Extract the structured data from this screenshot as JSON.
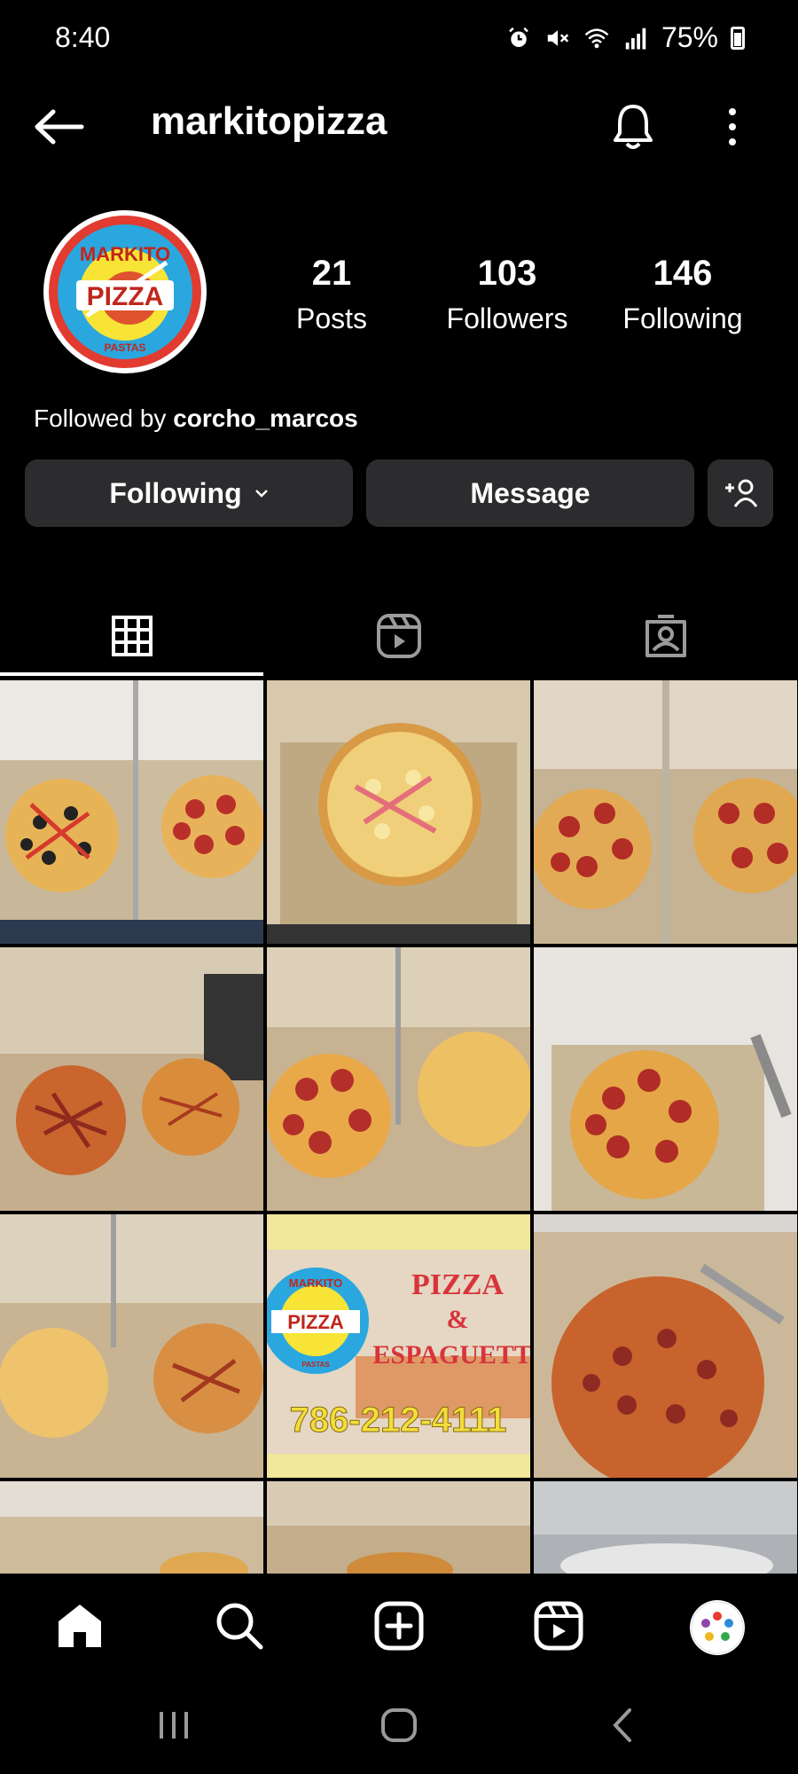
{
  "status_bar": {
    "time": "8:40",
    "battery": "75%",
    "icons": [
      "alarm-icon",
      "mute-icon",
      "wifi-icon",
      "signal-icon",
      "battery-icon"
    ]
  },
  "header": {
    "username": "markitopizza",
    "icons": [
      "back-arrow-icon",
      "bell-icon",
      "more-vertical-icon"
    ]
  },
  "profile": {
    "logo_text": {
      "top": "MARKITO",
      "main": "PIZZA",
      "bottom": "PASTAS"
    },
    "stats": [
      {
        "value": "21",
        "label": "Posts"
      },
      {
        "value": "103",
        "label": "Followers"
      },
      {
        "value": "146",
        "label": "Following"
      }
    ],
    "followed_by_prefix": "Followed by",
    "followed_by_user": "corcho_marcos"
  },
  "actions": {
    "following_label": "Following",
    "message_label": "Message"
  },
  "tabs": [
    {
      "name": "grid",
      "icon": "grid-icon",
      "active": true
    },
    {
      "name": "reels",
      "icon": "reels-icon",
      "active": false
    },
    {
      "name": "tagged",
      "icon": "tagged-icon",
      "active": false
    }
  ],
  "posts": [
    {
      "kind": "two-pizzas"
    },
    {
      "kind": "hawaiian-pizza"
    },
    {
      "kind": "two-pepperoni"
    },
    {
      "kind": "two-pizzas-bacon"
    },
    {
      "kind": "pepperoni-and-cheese"
    },
    {
      "kind": "pepperoni-box"
    },
    {
      "kind": "cheese-and-bacon"
    },
    {
      "kind": "promo",
      "text_top": "PIZZA",
      "text_mid": "&",
      "text_bottom": "ESPAGUETTI",
      "phone": "786-212-4111",
      "logo_main": "PIZZA",
      "logo_top": "MARKITO",
      "logo_bottom": "PASTAS"
    },
    {
      "kind": "pepperoni-closeup"
    },
    {
      "kind": "partial"
    },
    {
      "kind": "partial"
    },
    {
      "kind": "partial"
    }
  ],
  "bottom_nav": [
    "home-icon",
    "search-icon",
    "create-icon",
    "reels-icon",
    "profile-avatar"
  ],
  "colors": {
    "background": "#000000",
    "button": "#2c2c2e",
    "text": "#ffffff"
  }
}
